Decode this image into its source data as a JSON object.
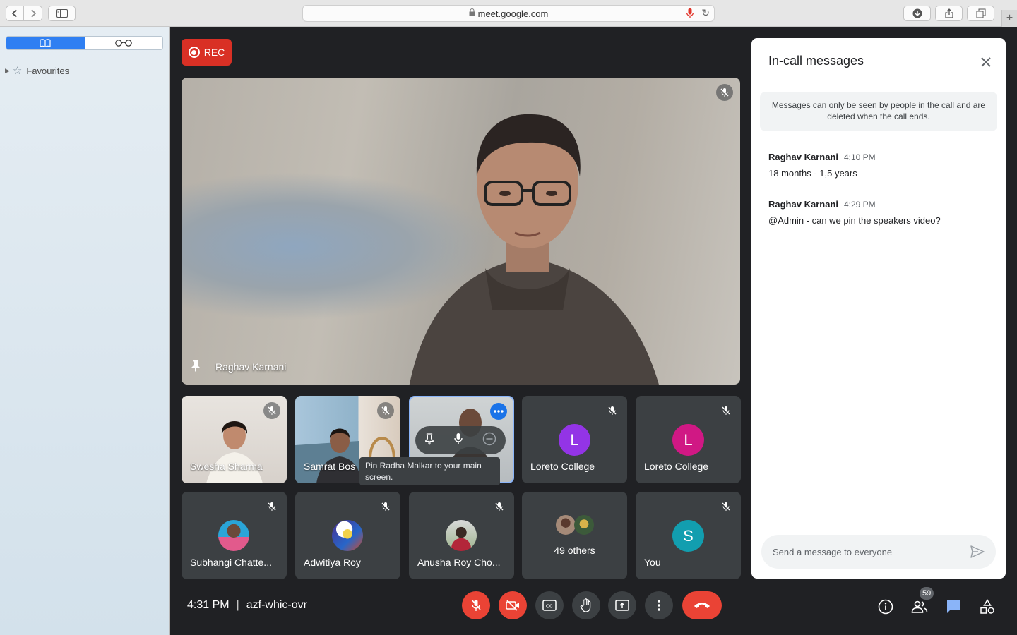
{
  "browser": {
    "url": "meet.google.com"
  },
  "sidebar": {
    "favourites_label": "Favourites"
  },
  "recording": {
    "label": "REC"
  },
  "main_speaker": {
    "name": "Raghav Karnani"
  },
  "tiles": [
    {
      "name": "Swesha Sharma"
    },
    {
      "name": "Samrat Bos"
    },
    {
      "name": "Radha Malkar"
    },
    {
      "name": "Loreto College",
      "initial": "L",
      "color": "#9334e6"
    },
    {
      "name": "Loreto College",
      "initial": "L",
      "color": "#d01884"
    },
    {
      "name": "Subhangi Chatte..."
    },
    {
      "name": "Adwitiya Roy"
    },
    {
      "name": "Anusha Roy Cho..."
    },
    {
      "name": "49 others"
    },
    {
      "name": "You",
      "initial": "S",
      "color": "#129eaf"
    }
  ],
  "tooltip": {
    "text": "Pin Radha Malkar to your main screen."
  },
  "meeting": {
    "time": "4:31 PM",
    "code": "azf-whic-ovr",
    "participant_count": "59"
  },
  "chat": {
    "title": "In-call messages",
    "notice": "Messages can only be seen by people in the call and are deleted when the call ends.",
    "messages": [
      {
        "sender": "Raghav Karnani",
        "time": "4:10 PM",
        "text": "18 months - 1,5 years"
      },
      {
        "sender": "Raghav Karnani",
        "time": "4:29 PM",
        "text": "@Admin - can we pin the speakers video?"
      }
    ],
    "input_placeholder": "Send a message to everyone"
  },
  "colors": {
    "accent": "#1a73e8",
    "danger": "#ea4335",
    "background": "#202124",
    "tile": "#3c4043"
  }
}
